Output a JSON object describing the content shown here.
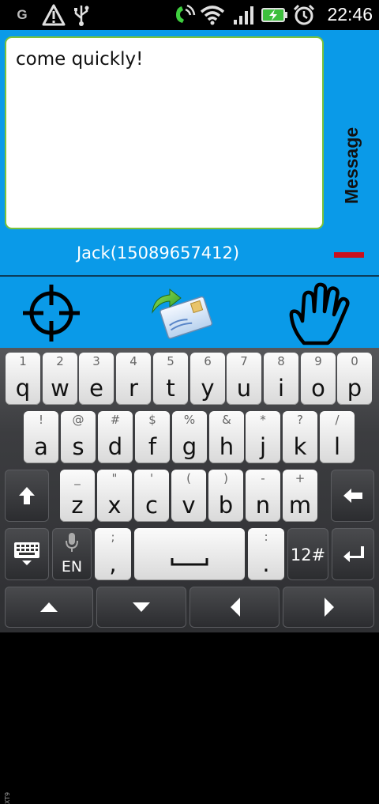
{
  "status_bar": {
    "network_letter": "G",
    "time": "22:46",
    "icons": [
      "warning-icon",
      "usb-icon",
      "phone-signal-icon",
      "wifi-icon",
      "cell-signal-icon",
      "battery-charging-icon",
      "alarm-clock-icon"
    ]
  },
  "message": {
    "text": "come quickly!",
    "side_label": "Message",
    "contact": "Jack(15089657412)"
  },
  "toolbar": {
    "buttons": [
      "crosshair-icon",
      "send-mail-icon",
      "hand-icon"
    ]
  },
  "keyboard": {
    "row1": [
      {
        "hint": "1",
        "key": "q"
      },
      {
        "hint": "2",
        "key": "w"
      },
      {
        "hint": "3",
        "key": "e"
      },
      {
        "hint": "4",
        "key": "r"
      },
      {
        "hint": "5",
        "key": "t"
      },
      {
        "hint": "6",
        "key": "y"
      },
      {
        "hint": "7",
        "key": "u"
      },
      {
        "hint": "8",
        "key": "i"
      },
      {
        "hint": "9",
        "key": "o"
      },
      {
        "hint": "0",
        "key": "p"
      }
    ],
    "row2": [
      {
        "hint": "!",
        "key": "a"
      },
      {
        "hint": "@",
        "key": "s"
      },
      {
        "hint": "#",
        "key": "d"
      },
      {
        "hint": "$",
        "key": "f"
      },
      {
        "hint": "%",
        "key": "g"
      },
      {
        "hint": "&",
        "key": "h"
      },
      {
        "hint": "*",
        "key": "j"
      },
      {
        "hint": "?",
        "key": "k"
      },
      {
        "hint": "/",
        "key": "l"
      }
    ],
    "row3": [
      {
        "hint": "_",
        "key": "z"
      },
      {
        "hint": "\"",
        "key": "x"
      },
      {
        "hint": "'",
        "key": "c"
      },
      {
        "hint": "(",
        "key": "v"
      },
      {
        "hint": ")",
        "key": "b"
      },
      {
        "hint": "-",
        "key": "n"
      },
      {
        "hint": "+",
        "key": "m"
      }
    ],
    "side_label": "XT9",
    "lang": "EN",
    "comma_hint": ";",
    "comma": ",",
    "period_hint": ":",
    "period": ".",
    "symbols": "12#"
  }
}
